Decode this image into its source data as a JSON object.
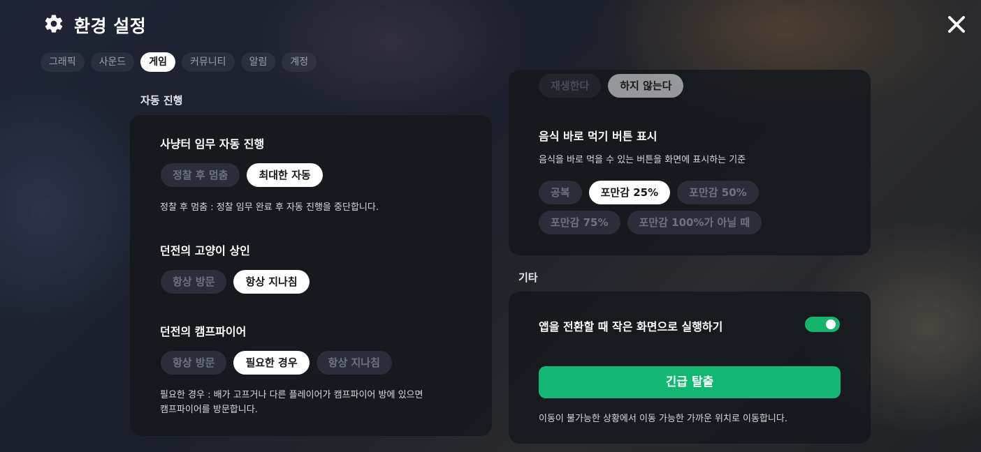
{
  "header": {
    "title": "환경 설정",
    "gear_icon": "gear-icon",
    "close_icon": "close-icon"
  },
  "tabs": [
    {
      "label": "그래픽",
      "active": false
    },
    {
      "label": "사운드",
      "active": false
    },
    {
      "label": "게임",
      "active": true
    },
    {
      "label": "커뮤니티",
      "active": false
    },
    {
      "label": "알림",
      "active": false
    },
    {
      "label": "계정",
      "active": false
    }
  ],
  "auto_progress": {
    "section_label": "자동 진행",
    "hunt_mission": {
      "title": "사냥터 임무 자동 진행",
      "options": [
        "정찰 후 멈춤",
        "최대한 자동"
      ],
      "selected": "최대한 자동",
      "description": "정찰 후 멈춤 : 정찰 임무 완료 후 자동 진행을 중단합니다."
    },
    "dungeon_cat_merchant": {
      "title": "던전의 고양이 상인",
      "options": [
        "항상 방문",
        "항상 지나침"
      ],
      "selected": "항상 지나침"
    },
    "dungeon_campfire": {
      "title": "던전의 캠프파이어",
      "options": [
        "항상 방문",
        "필요한 경우",
        "항상 지나침"
      ],
      "selected": "필요한 경우",
      "description_line1": "필요한 경우 : 배가 고프거나 다른 플레이어가 캠프파이어 방에 있으면",
      "description_line2": "캠프파이어를 방문합니다."
    }
  },
  "partial_options": {
    "options": [
      "재생한다",
      "하지 않는다"
    ],
    "selected": "하지 않는다"
  },
  "eat_button": {
    "title": "음식 바로 먹기 버튼 표시",
    "description": "음식을 바로 먹을 수 있는 버튼을 화면에 표시하는 기준",
    "options": [
      "공복",
      "포만감 25%",
      "포만감 50%",
      "포만감 75%",
      "포만감 100%가 아닐 때"
    ],
    "selected": "포만감 25%"
  },
  "etc": {
    "section_label": "기타",
    "small_screen_label": "앱을 전환할 때 작은 화면으로 실행하기",
    "small_screen_enabled": true,
    "emergency_label": "긴급 탈출",
    "emergency_description": "이동이 불가능한 상황에서 이동 가능한 가까운 위치로 이동합니다."
  },
  "colors": {
    "accent_green": "#12b871",
    "chip_selected": "#ffffff",
    "chip_default": "#2b2e38"
  }
}
